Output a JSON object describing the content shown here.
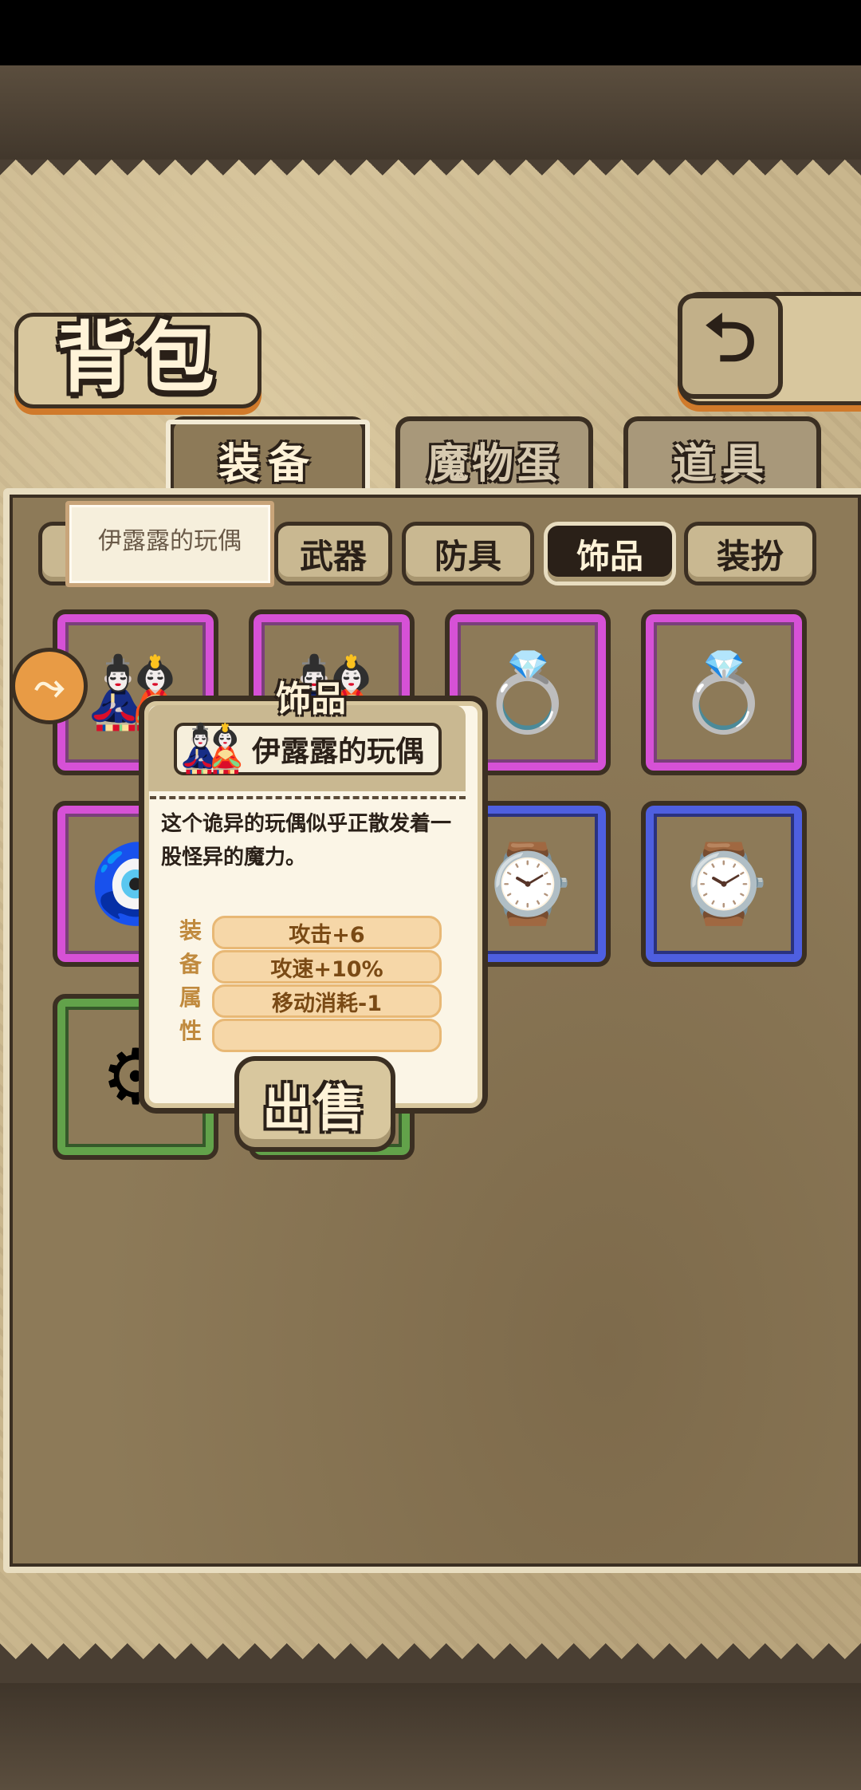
{
  "header": {
    "title": "背包",
    "back_icon": "back-arrow-icon"
  },
  "tabs": [
    {
      "label": "装备",
      "active": true
    },
    {
      "label": "魔物蛋",
      "active": false
    },
    {
      "label": "道具",
      "active": false
    }
  ],
  "filters": [
    {
      "label": "武器",
      "active": false
    },
    {
      "label": "防具",
      "active": false
    },
    {
      "label": "饰品",
      "active": true
    },
    {
      "label": "装扮",
      "active": false
    }
  ],
  "name_tooltip": "伊露露的玩偶",
  "slots": [
    {
      "rarity": "purple",
      "icon": "doll-icon"
    },
    {
      "rarity": "purple",
      "icon": "doll-icon"
    },
    {
      "rarity": "purple",
      "icon": "ring-icon"
    },
    {
      "rarity": "purple",
      "icon": "ring-icon"
    },
    {
      "rarity": "purple",
      "icon": "eye-orb-icon"
    },
    {
      "rarity": "blue",
      "icon": "gauntlet-icon"
    },
    {
      "rarity": "blue",
      "icon": "gauntlet-icon"
    },
    {
      "rarity": "blue",
      "icon": "gauntlet-icon"
    },
    {
      "rarity": "green",
      "icon": "broken-wheel-icon"
    },
    {
      "rarity": "green",
      "icon": "broken-wheel-icon"
    }
  ],
  "detail": {
    "category": "饰品",
    "name": "伊露露的玩偶",
    "description": "这个诡异的玩偶似乎正散发着一股怪异的魔力。",
    "attr_label": [
      "装",
      "备",
      "属",
      "性"
    ],
    "attributes": [
      "攻击+6",
      "攻速+10%",
      "移动消耗-1",
      ""
    ],
    "sell_label": "出售"
  },
  "colors": {
    "purple_frame": "#d651d6",
    "blue_frame": "#4e5fe0",
    "green_frame": "#62a24a",
    "attr_text": "#7a4a15",
    "accent_orange": "#e89b45"
  }
}
